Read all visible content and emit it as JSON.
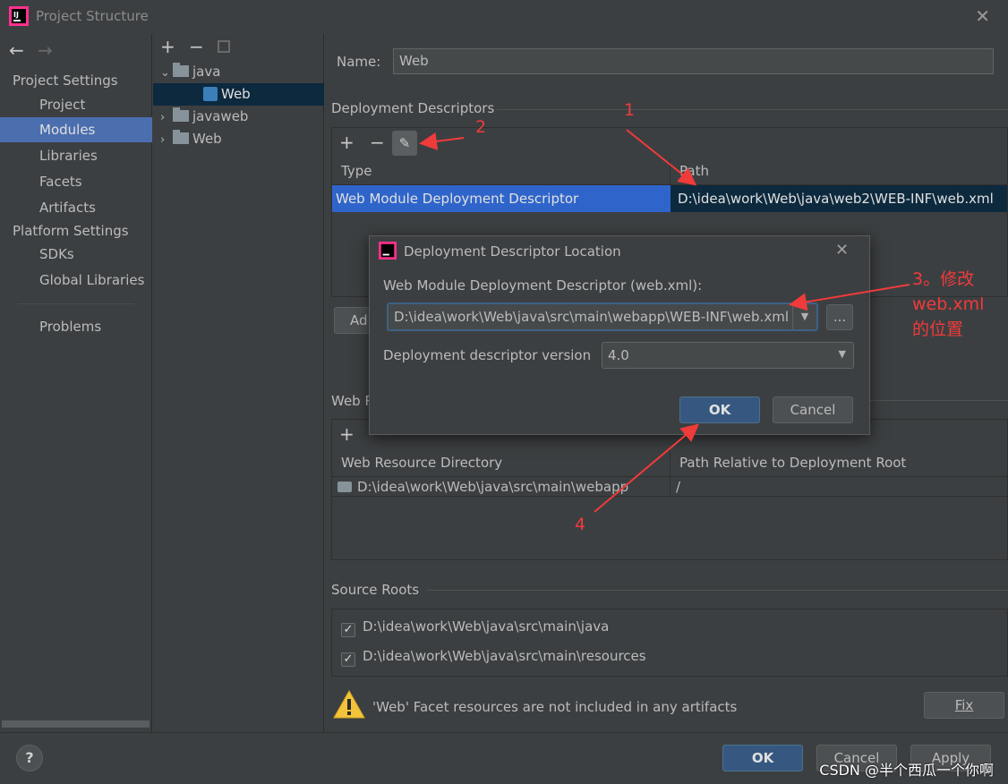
{
  "window": {
    "title": "Project Structure",
    "close_icon": "close-icon"
  },
  "nav": {
    "back_icon": "arrow-left-icon",
    "forward_icon": "arrow-right-icon",
    "project_settings": "Project Settings",
    "items_project": [
      "Project",
      "Modules",
      "Libraries",
      "Facets",
      "Artifacts"
    ],
    "platform_settings": "Platform Settings",
    "items_platform": [
      "SDKs",
      "Global Libraries"
    ],
    "problems": "Problems",
    "selected": "Modules"
  },
  "tree": {
    "toolbar": [
      "+",
      "−"
    ],
    "nodes": [
      {
        "label": "java",
        "expanded": true
      },
      {
        "label": "Web",
        "selected": true
      },
      {
        "label": "javaweb",
        "expanded": false
      },
      {
        "label": "Web",
        "expanded": false
      }
    ]
  },
  "facet": {
    "name_label": "Name:",
    "name_value": "Web",
    "deployment_descriptors_label": "Deployment Descriptors",
    "dd_columns": [
      "Type",
      "Path"
    ],
    "dd_row": {
      "type": "Web Module Deployment Descriptor",
      "path": "D:\\idea\\work\\Web\\java\\web2\\WEB-INF\\web.xml"
    },
    "add_button_partial": "Ad",
    "web_resource_label_partial": "Web R",
    "wr_columns": [
      "Web Resource Directory",
      "Path Relative to Deployment Root"
    ],
    "wr_row": {
      "dir": "D:\\idea\\work\\Web\\java\\src\\main\\webapp",
      "rel": "/"
    },
    "source_roots_label": "Source Roots",
    "source_roots": [
      "D:\\idea\\work\\Web\\java\\src\\main\\java",
      "D:\\idea\\work\\Web\\java\\src\\main\\resources"
    ],
    "warning": "'Web' Facet resources are not included in any artifacts",
    "fix_button": "Fix"
  },
  "dialog": {
    "title": "Deployment Descriptor Location",
    "field_label": "Web Module Deployment Descriptor (web.xml):",
    "path_value": "D:\\idea\\work\\Web\\java\\src\\main\\webapp\\WEB-INF\\web.xml",
    "browse": "...",
    "version_label": "Deployment descriptor version",
    "version_value": "4.0",
    "ok": "OK",
    "cancel": "Cancel"
  },
  "annotations": {
    "a1": "1",
    "a2": "2",
    "a3_line1": "3。修改",
    "a3_line2": "web.xml",
    "a3_line3": "的位置",
    "a4": "4",
    "color": "#f03b3b"
  },
  "footer": {
    "help": "?",
    "ok": "OK",
    "cancel": "Cancel",
    "apply": "Apply",
    "watermark": "CSDN @半个西瓜一个你啊"
  }
}
